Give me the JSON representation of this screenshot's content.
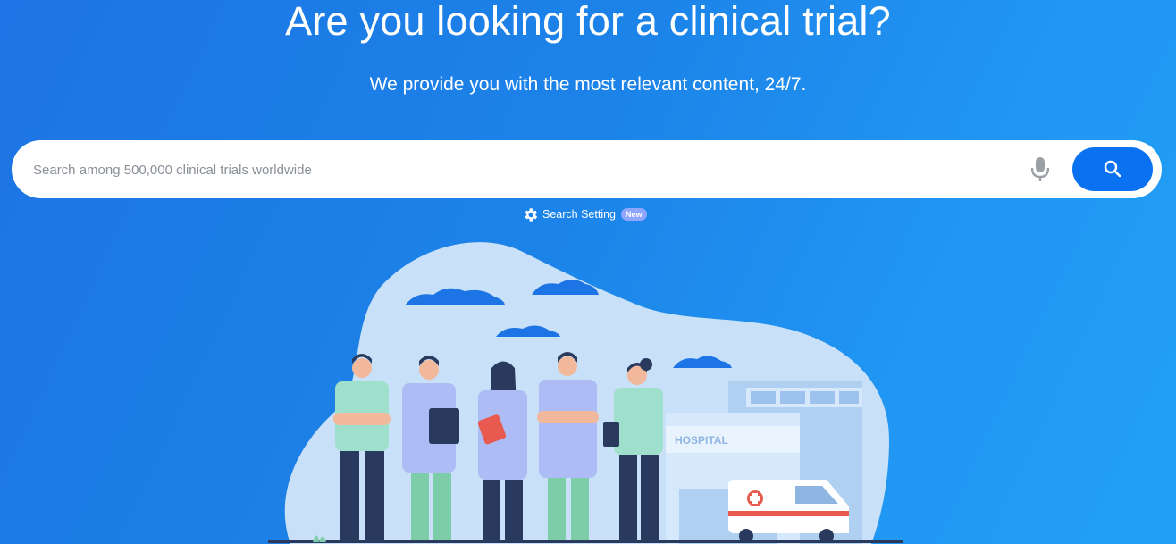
{
  "hero": {
    "title": "Are you looking for a clinical trial?",
    "subtitle": "We provide you with the most relevant content, 24/7."
  },
  "search": {
    "placeholder": "Search among 500,000 clinical trials worldwide",
    "value": "",
    "mic_icon": "microphone-icon",
    "button_icon": "search-icon"
  },
  "settings": {
    "label": "Search Setting",
    "badge": "New",
    "icon": "gear-icon"
  },
  "illustration": {
    "building_sign": "HOSPITAL"
  },
  "colors": {
    "background": "#1c83e8",
    "search_button": "#0a72f0",
    "badge": "#8fa6ff",
    "blob": "#c8e0f8"
  }
}
